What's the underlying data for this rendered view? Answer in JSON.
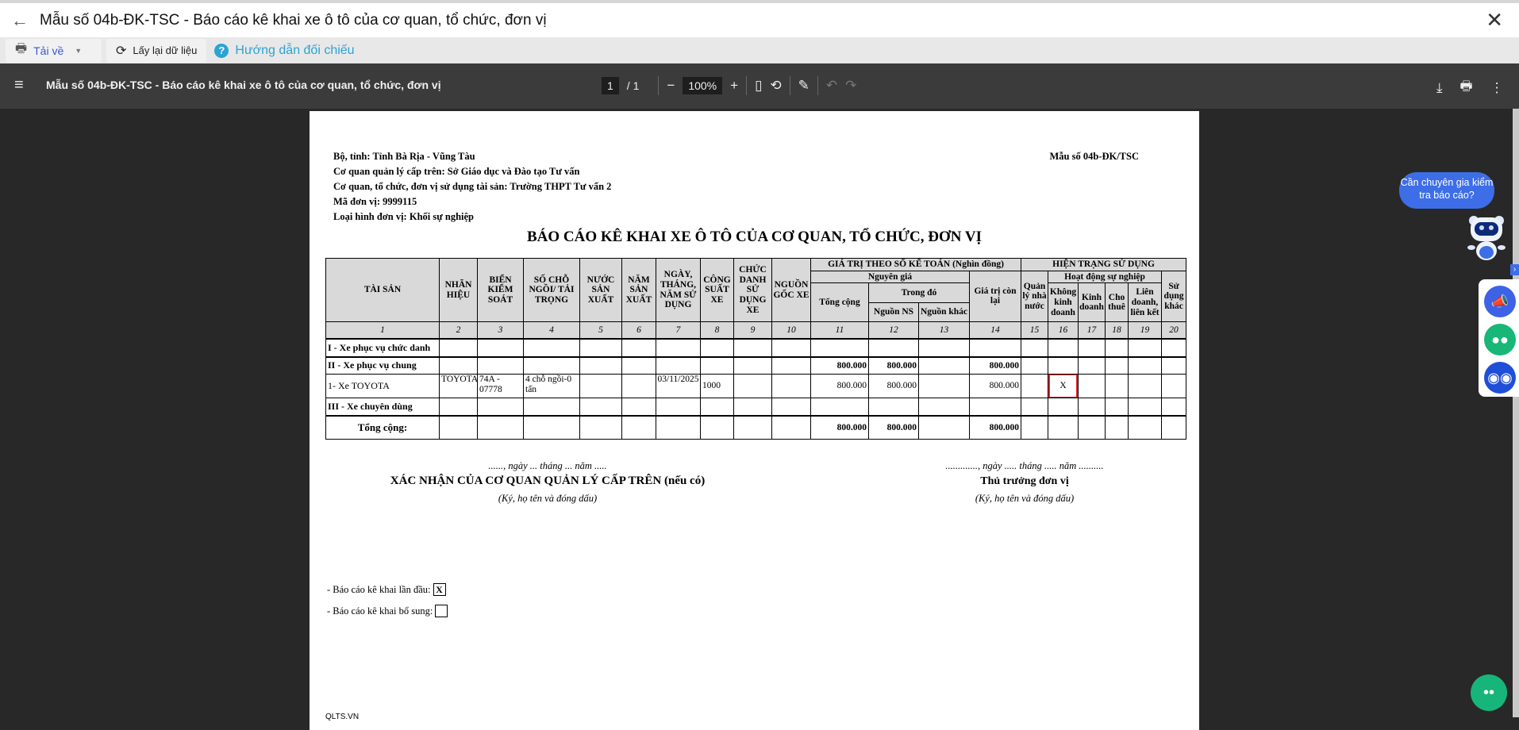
{
  "app": {
    "title": "Mẫu số 04b-ĐK-TSC - Báo cáo kê khai xe ô tô của cơ quan, tổ chức, đơn vị"
  },
  "toolbar": {
    "download": "Tải về",
    "reload": "Lấy lại dữ liệu",
    "help": "Hướng dẫn đối chiếu"
  },
  "viewer": {
    "title": "Mẫu số 04b-ĐK-TSC - Báo cáo kê khai xe ô tô của cơ quan, tổ chức, đơn vị",
    "page": "1",
    "page_total": "/ 1",
    "zoom": "100%"
  },
  "doc": {
    "header": [
      "Bộ, tỉnh: Tỉnh Bà Rịa - Vũng Tàu",
      "Cơ quan quản lý cấp trên: Sở Giáo dục và Đào tạo Tư vấn",
      "Cơ quan, tổ chức, đơn vị sử dụng tài sản: Trường THPT Tư vấn 2",
      "Mã đơn vị: 9999115",
      "Loại hình đơn vị: Khối sự nghiệp"
    ],
    "form_no": "Mẫu số 04b-ĐK/TSC",
    "title": "BÁO CÁO KÊ KHAI XE Ô TÔ CỦA CƠ QUAN, TỔ CHỨC, ĐƠN VỊ",
    "cols": {
      "c1": "TÀI SẢN",
      "c2": "NHÃN HIỆU",
      "c3": "BIỂN KIỂM SOÁT",
      "c4": "SỐ CHỖ NGỒI/ TẢI TRỌNG",
      "c5": "NƯỚC SẢN XUẤT",
      "c6": "NĂM SẢN XUẤT",
      "c7": "NGÀY, THÁNG, NĂM SỬ DỤNG",
      "c8": "CÔNG SUẤT XE",
      "c9": "CHỨC DANH SỬ DỤNG XE",
      "c10": "NGUỒN GỐC XE",
      "value_group": "GIÁ TRỊ THEO SỔ KẾ TOÁN (Nghìn đồng)",
      "status_group": "HIỆN TRẠNG SỬ DỤNG",
      "orig": "Nguyên giá",
      "remain": "Giá trị còn lại",
      "state": "Quản lý nhà nước",
      "career": "Hoạt động sự nghiệp",
      "other_use": "Sử dụng khác",
      "total": "Tổng cộng",
      "of_which": "Trong đó",
      "nonbiz": "Không kinh doanh",
      "biz": "Kinh doanh",
      "rent": "Cho thuê",
      "joint": "Liên doanh, liên kết",
      "ns": "Nguồn NS",
      "other_src": "Nguồn khác"
    },
    "col_numbers": [
      "1",
      "2",
      "3",
      "4",
      "5",
      "6",
      "7",
      "8",
      "9",
      "10",
      "11",
      "12",
      "13",
      "14",
      "15",
      "16",
      "17",
      "18",
      "19",
      "20"
    ],
    "rows": [
      {
        "type": "group",
        "cells": [
          "I - Xe phục vụ chức danh",
          "",
          "",
          "",
          "",
          "",
          "",
          "",
          "",
          "",
          "",
          "",
          "",
          "",
          "",
          "",
          "",
          "",
          "",
          ""
        ]
      },
      {
        "type": "group",
        "cells": [
          "II - Xe phục vụ chung",
          "",
          "",
          "",
          "",
          "",
          "",
          "",
          "",
          "",
          "800.000",
          "800.000",
          "",
          "800.000",
          "",
          "",
          "",
          "",
          "",
          ""
        ]
      },
      {
        "type": "item",
        "cells": [
          "1- Xe TOYOTA",
          "TOYOTA",
          "74A - 07778",
          "4 chỗ ngồi-0 tấn",
          "",
          "",
          "03/11/2025",
          "1000",
          "",
          "",
          "800.000",
          "800.000",
          "",
          "800.000",
          "",
          "X",
          "",
          "",
          "",
          ""
        ]
      },
      {
        "type": "group",
        "cells": [
          "III - Xe chuyên dùng",
          "",
          "",
          "",
          "",
          "",
          "",
          "",
          "",
          "",
          "",
          "",
          "",
          "",
          "",
          "",
          "",
          "",
          "",
          ""
        ]
      },
      {
        "type": "total",
        "cells": [
          "Tổng cộng:",
          "",
          "",
          "",
          "",
          "",
          "",
          "",
          "",
          "",
          "800.000",
          "800.000",
          "",
          "800.000",
          "",
          "",
          "",
          "",
          "",
          ""
        ]
      }
    ],
    "sign_left": {
      "date": "......, ngày ... tháng ... năm .....",
      "title": "XÁC NHẬN CỦA CƠ QUAN QUẢN LÝ CẤP TRÊN (nếu có)",
      "note": "(Ký, họ tên và đóng dấu)"
    },
    "sign_right": {
      "date": "............., ngày ..... tháng ..... năm ..........",
      "title": "Thủ trưởng đơn vị",
      "note": "(Ký, họ tên và đóng dấu)"
    },
    "first_report": {
      "label": "- Báo cáo kê khai lần đầu:",
      "value": "X"
    },
    "supplement": {
      "label": "- Báo cáo kê khai bổ sung:",
      "value": ""
    },
    "footer": "QLTS.VN"
  },
  "assistant": {
    "bubble": "Cần chuyên gia kiểm tra báo cáo?"
  }
}
